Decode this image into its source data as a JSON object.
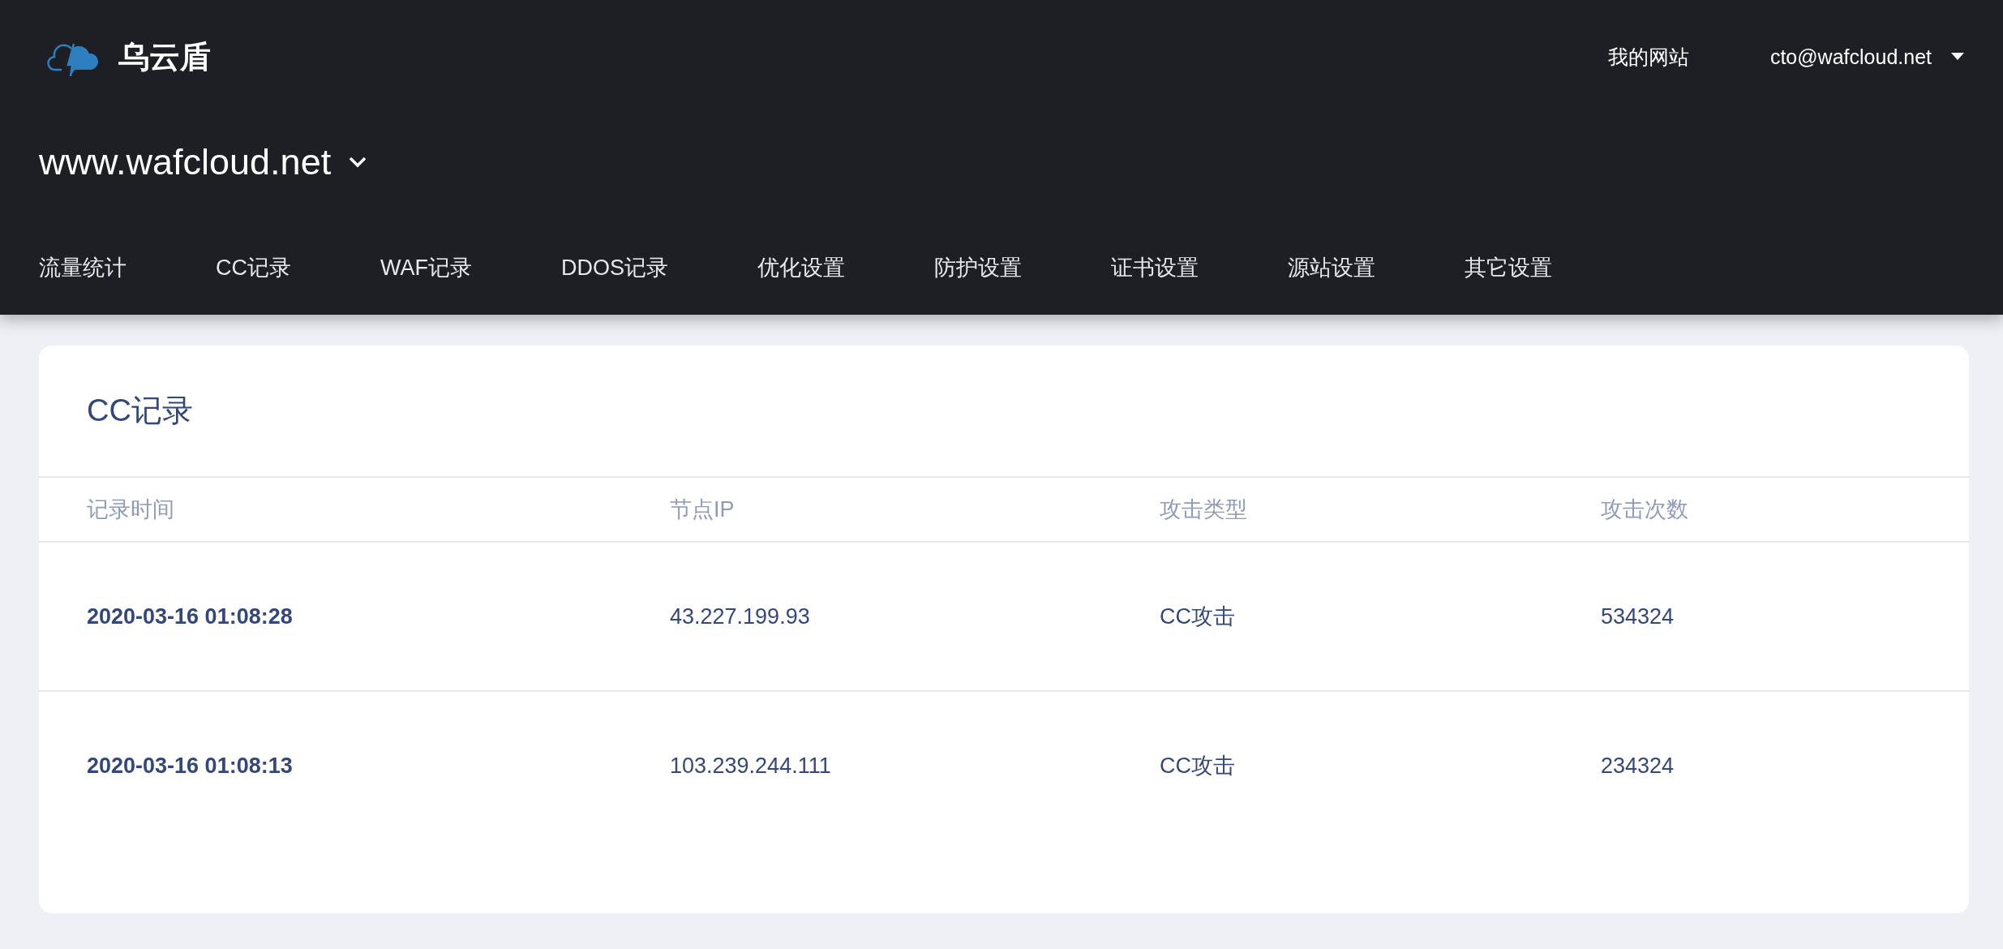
{
  "brand": {
    "name": "乌云盾"
  },
  "top_links": [
    {
      "label": "我的网站",
      "dropdown": false
    },
    {
      "label": "cto@wafcloud.net",
      "dropdown": true
    }
  ],
  "site_selector": {
    "value": "www.wafcloud.net"
  },
  "nav": [
    "流量统计",
    "CC记录",
    "WAF记录",
    "DDOS记录",
    "优化设置",
    "防护设置",
    "证书设置",
    "源站设置",
    "其它设置"
  ],
  "card": {
    "title": "CC记录",
    "table": {
      "columns": [
        "记录时间",
        "节点IP",
        "攻击类型",
        "攻击次数"
      ],
      "rows": [
        [
          "2020-03-16 01:08:28",
          "43.227.199.93",
          "CC攻击",
          "534324"
        ],
        [
          "2020-03-16 01:08:13",
          "103.239.244.111",
          "CC攻击",
          "234324"
        ]
      ]
    }
  }
}
